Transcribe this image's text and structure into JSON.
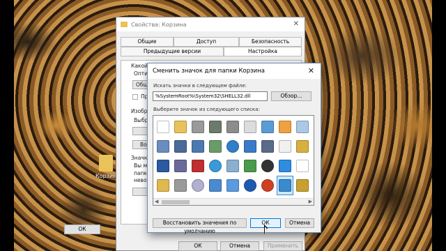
{
  "desktop": {
    "icon_label": "Корзина"
  },
  "props_window": {
    "title": "Свойства: Корзина",
    "tabs_row1": [
      "Общие",
      "Доступ",
      "Безопасность"
    ],
    "tabs_row2": [
      "Предыдущие версии",
      "Настройка"
    ],
    "fragments": [
      "Какой",
      "Опти",
      "Обще",
      "Пр",
      "Изобр",
      "Выбр",
      "Вос",
      "Значк",
      "Вы мо",
      "папки",
      "невоз"
    ],
    "buttons": {
      "ok": "ОК",
      "cancel": "Отмена",
      "apply": "Применить"
    }
  },
  "dialog": {
    "title": "Сменить значок для папки Корзина",
    "search_label": "Искать значки в следующем файле:",
    "path_value": "%SystemRoot%\\System32\\SHELL32.dll",
    "browse_label": "Обзор...",
    "list_label": "Выберите значок из следующего списка:",
    "restore_label": "Восстановить значения по умолчанию",
    "ok_label": "ОК",
    "cancel_label": "Отмена",
    "icons": [
      {
        "name": "blank-document-icon",
        "color": "#ffffff"
      },
      {
        "name": "folder-icon",
        "color": "#e9c35a"
      },
      {
        "name": "drive-icon",
        "color": "#9a9a9a"
      },
      {
        "name": "chip-icon",
        "color": "#6c7a6c"
      },
      {
        "name": "drive-icon",
        "color": "#8c8c8c"
      },
      {
        "name": "clock-document-icon",
        "color": "#dcdcdc"
      },
      {
        "name": "monitor-icon",
        "color": "#5b9bd5"
      },
      {
        "name": "hand-icon",
        "color": "#f0a040"
      },
      {
        "name": "recycle-bin-icon",
        "color": "#aac8e8"
      },
      {
        "name": "printer-document-icon",
        "color": "#6a8cc0"
      },
      {
        "name": "window-icon",
        "color": "#4a6a9a"
      },
      {
        "name": "computer-icon",
        "color": "#4a7ab0"
      },
      {
        "name": "network-icon",
        "color": "#6a9c6a"
      },
      {
        "name": "globe-icon",
        "color": "#2f7fc8"
      },
      {
        "name": "monitor-icon",
        "color": "#3a7ac8"
      },
      {
        "name": "remote-icon",
        "color": "#5a6a8a"
      },
      {
        "name": "shortcut-arrow-icon",
        "color": "#f0f0f0"
      },
      {
        "name": "folder-icon",
        "color": "#d8b040"
      },
      {
        "name": "window-icon",
        "color": "#2a5aa0"
      },
      {
        "name": "floppy-icon",
        "color": "#6a6a9a"
      },
      {
        "name": "delete-drive-icon",
        "color": "#c03030"
      },
      {
        "name": "globe-icon",
        "color": "#3a9ad8"
      },
      {
        "name": "search-icon",
        "color": "#8ab0d0"
      },
      {
        "name": "arrow-drive-icon",
        "color": "#4a9a4a"
      },
      {
        "name": "cd-icon",
        "color": "#333333"
      },
      {
        "name": "window-icon",
        "color": "#2f8ce0"
      },
      {
        "name": "document-icon",
        "color": "#ffffff"
      },
      {
        "name": "folder-icon",
        "color": "#e0b850"
      },
      {
        "name": "drive-icon",
        "color": "#9a9a9a"
      },
      {
        "name": "cd-icon",
        "color": "#b0b0d0"
      },
      {
        "name": "laptop-icon",
        "color": "#4a8ad0"
      },
      {
        "name": "pencil-icon",
        "color": "#5a9ae0"
      },
      {
        "name": "help-icon",
        "color": "#1e5ab0"
      },
      {
        "name": "power-icon",
        "color": "#d04020"
      },
      {
        "name": "recycle-bin-icon",
        "color": "#3a8ad0"
      },
      {
        "name": "folder-icon",
        "color": "#c8a030"
      }
    ]
  }
}
